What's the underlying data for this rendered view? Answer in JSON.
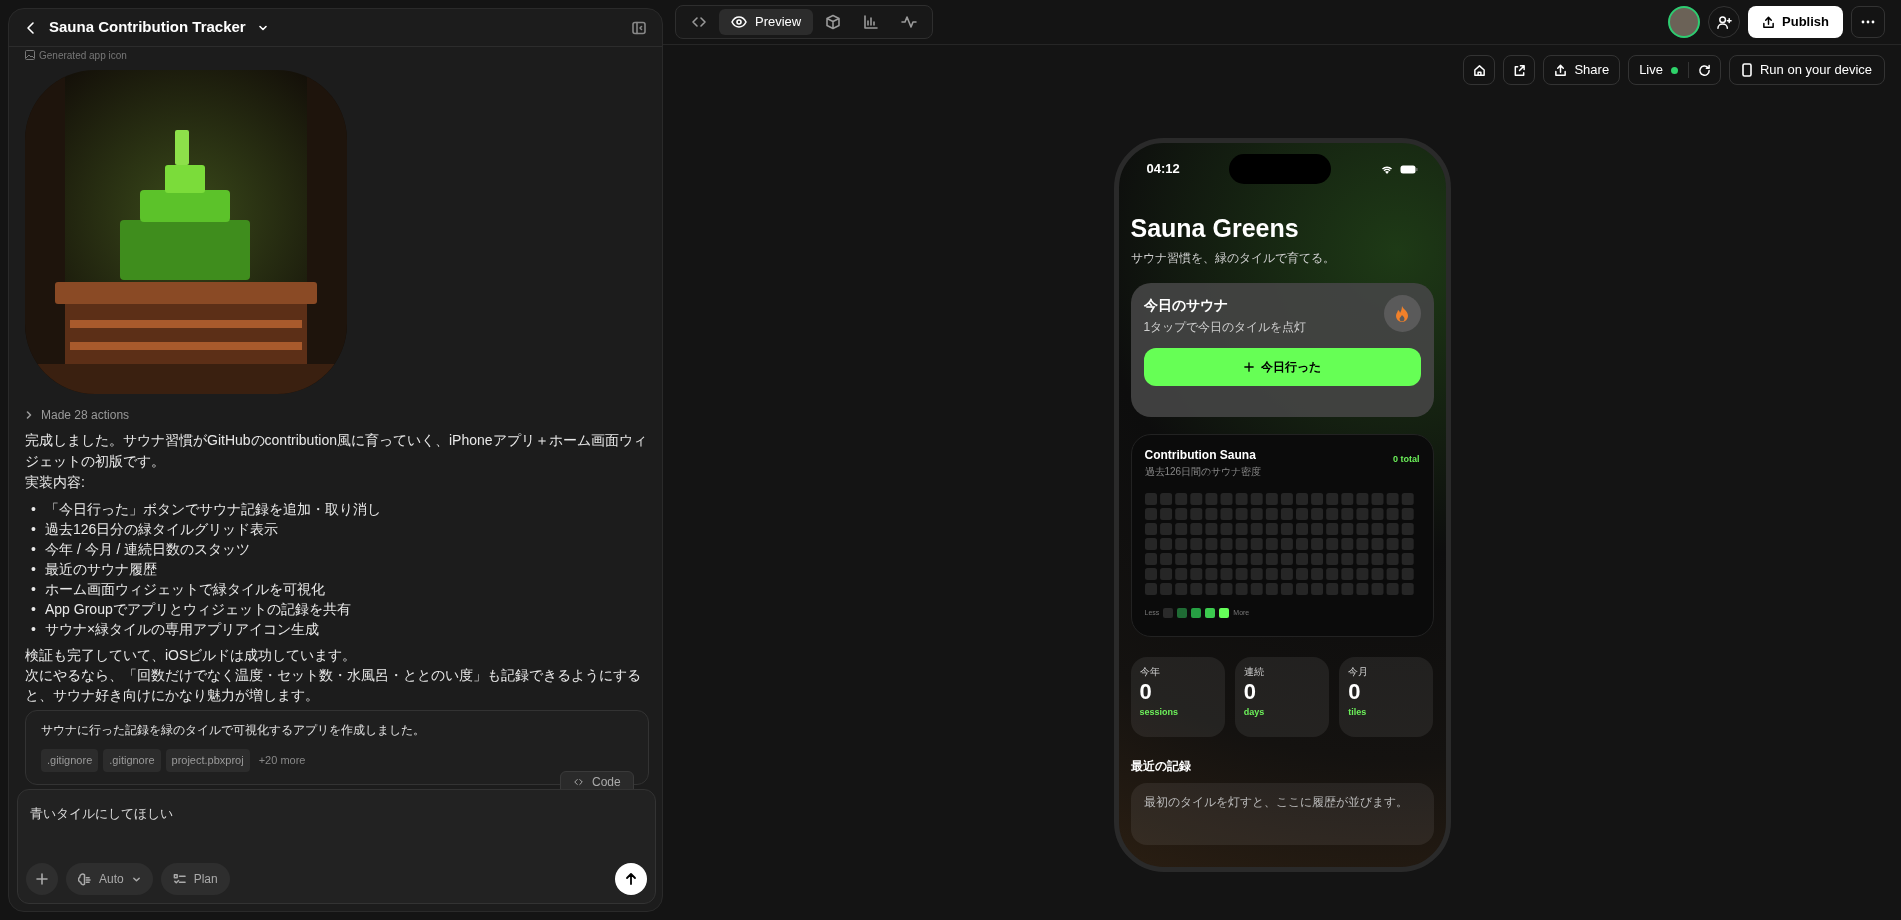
{
  "header": {
    "title": "Sauna Contribution Tracker"
  },
  "chat": {
    "artifact_label": "Generated app icon",
    "actions_summary": "Made 28 actions",
    "intro": [
      "完成しました。サウナ習慣がGitHubのcontribution風に育っていく、iPhoneアプリ＋ホーム画面ウィジェットの初版です。",
      "実装内容:"
    ],
    "bullet_marker": "•",
    "bullets": [
      "「今日行った」ボタンでサウナ記録を追加・取り消し",
      "過去126日分の緑タイルグリッド表示",
      "今年 / 今月 / 連続日数のスタッツ",
      "最近のサウナ履歴",
      "ホーム画面ウィジェットで緑タイルを可視化",
      "App Groupでアプリとウィジェットの記録を共有",
      "サウナ×緑タイルの専用アプリアイコン生成"
    ],
    "outro": [
      "検証も完了していて、iOSビルドは成功しています。",
      "次にやるなら、「回数だけでなく温度・セット数・水風呂・ととのい度」も記録できるようにすると、サウナ好き向けにかなり魅力が増します。"
    ],
    "commit": {
      "message": "サウナに行った記録を緑のタイルで可視化するアプリを作成しました。",
      "files": [
        ".gitignore",
        ".gitignore",
        "project.pbxproj"
      ],
      "more": "+20 more",
      "code_button": "Code"
    }
  },
  "composer": {
    "value": "青いタイルにしてほしい",
    "mode": "Auto",
    "plan": "Plan"
  },
  "toolbar": {
    "view_tabs": [
      {
        "kind": "code",
        "selected": false
      },
      {
        "kind": "preview",
        "label": "Preview",
        "selected": true
      },
      {
        "kind": "cube",
        "selected": false
      },
      {
        "kind": "chart",
        "selected": false
      },
      {
        "kind": "pulse",
        "selected": false
      }
    ],
    "publish": "Publish"
  },
  "preview_bar": {
    "share": "Share",
    "live": {
      "label": "Live",
      "on": true
    },
    "run": "Run on your device"
  },
  "phone": {
    "time": "04:12",
    "title": "Sauna Greens",
    "subtitle": "サウナ習慣を、緑のタイルで育てる。",
    "today_card": {
      "title": "今日のサウナ",
      "subtitle": "1タップで今日のタイルを点灯",
      "button": "今日行った"
    },
    "contribution": {
      "title": "Contribution Sauna",
      "subtitle": "過去126日間のサウナ密度",
      "total": "0 total",
      "legend_less": "Less",
      "legend_more": "More",
      "legend": [
        {
          "color": "#2a2a2a"
        },
        {
          "color": "#1f6b34"
        },
        {
          "color": "#26a043"
        },
        {
          "color": "#3ccb4f"
        },
        {
          "color": "#66ff5a"
        }
      ]
    },
    "stats": [
      {
        "label": "今年",
        "value": "0",
        "unit": "sessions"
      },
      {
        "label": "連続",
        "value": "0",
        "unit": "days"
      },
      {
        "label": "今月",
        "value": "0",
        "unit": "tiles"
      }
    ],
    "recent": {
      "title": "最近の記録",
      "empty": "最初のタイルを灯すと、ここに履歴が並びます。"
    }
  }
}
